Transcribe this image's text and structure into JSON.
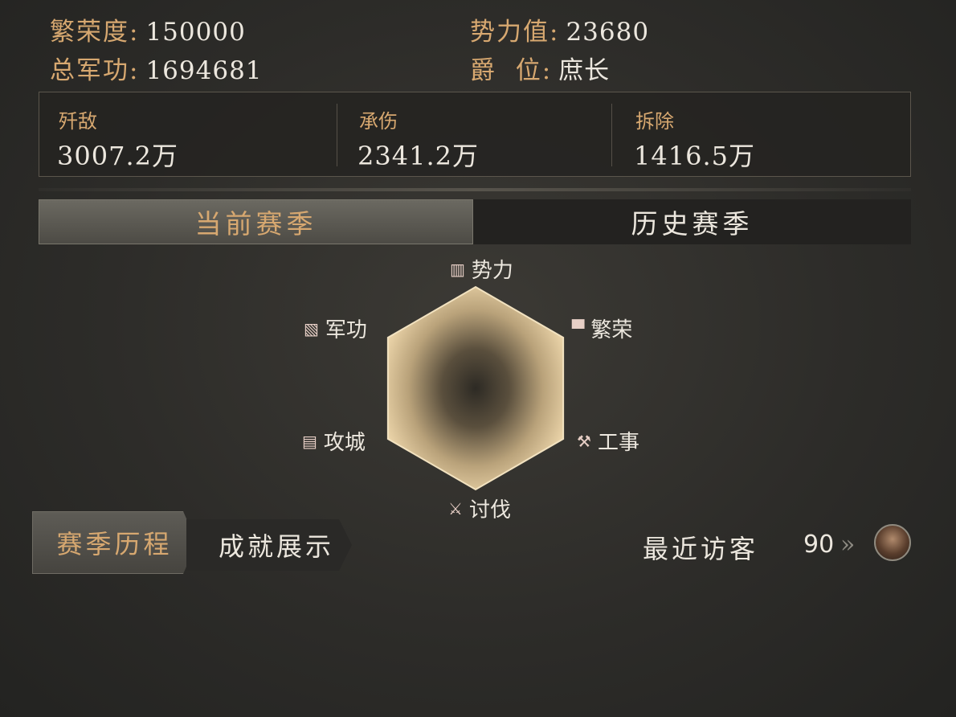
{
  "stats": {
    "prosperity_label": "繁荣度:",
    "prosperity_value": "150000",
    "power_label": "势力值:",
    "power_value": "23680",
    "merit_label": "总军功:",
    "merit_value": "1694681",
    "rank_label": "爵  位:",
    "rank_value": "庶长"
  },
  "summary": [
    {
      "label": "歼敌",
      "value": "3007.2万"
    },
    {
      "label": "承伤",
      "value": "2341.2万"
    },
    {
      "label": "拆除",
      "value": "1416.5万"
    }
  ],
  "tabs": {
    "current": "当前赛季",
    "history": "历史赛季"
  },
  "radar": {
    "axes": [
      {
        "label": "势力",
        "icon": "scroll-icon"
      },
      {
        "label": "繁荣",
        "icon": "house-icon"
      },
      {
        "label": "工事",
        "icon": "hammer-icon"
      },
      {
        "label": "讨伐",
        "icon": "crossed-swords-icon"
      },
      {
        "label": "攻城",
        "icon": "wall-icon"
      },
      {
        "label": "军功",
        "icon": "map-icon"
      }
    ],
    "values": [
      1,
      1,
      1,
      1,
      1,
      1
    ],
    "fill_color": "#ead3a8"
  },
  "bottom": {
    "season_progress": "赛季历程",
    "achievements": "成就展示",
    "recent_visitors": "最近访客",
    "visitor_count": "90",
    "arrow": "»"
  }
}
